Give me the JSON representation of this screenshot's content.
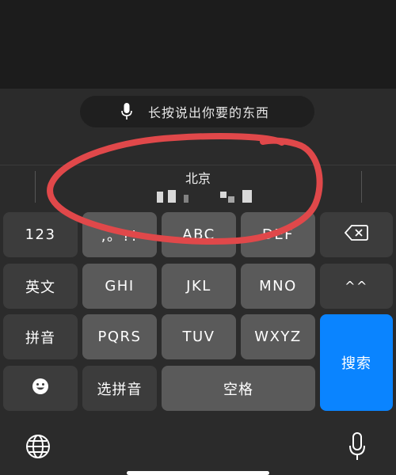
{
  "voice_input": {
    "label": "长按说出你要的东西"
  },
  "candidates": {
    "primary": "北京"
  },
  "keys": {
    "row1": [
      "123",
      ",。?!",
      "ABC",
      "DEF"
    ],
    "row2": [
      "英文",
      "GHI",
      "JKL",
      "MNO",
      "^^"
    ],
    "row3": [
      "拼音",
      "PQRS",
      "TUV",
      "WXYZ"
    ],
    "row4": [
      "选拼音",
      "空格"
    ],
    "search": "搜索",
    "backspace_icon": "delete-backward-icon",
    "emoji_icon": "smiley-icon"
  },
  "bottom_bar": {
    "left_icon": "globe-icon",
    "right_icon": "microphone-icon"
  },
  "colors": {
    "accent": "#0a84ff",
    "annotation": "#e0484a"
  }
}
